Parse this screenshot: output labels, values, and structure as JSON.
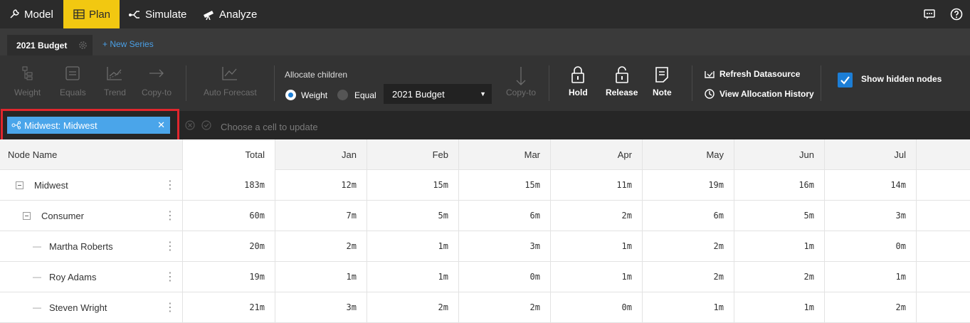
{
  "nav": {
    "model": "Model",
    "plan": "Plan",
    "simulate": "Simulate",
    "analyze": "Analyze",
    "active": "plan",
    "accent_color": "#f2c811"
  },
  "tabs": {
    "active_tab": "2021 Budget",
    "new_series": "+ New Series"
  },
  "ribbon": {
    "weight": "Weight",
    "equals": "Equals",
    "trend": "Trend",
    "copy_to_left": "Copy-to",
    "auto_forecast": "Auto Forecast",
    "allocate_children": "Allocate children",
    "radio_weight": "Weight",
    "radio_equal": "Equal",
    "radio_selected": "Weight",
    "series_select": "2021 Budget",
    "copy_to_right": "Copy-to",
    "hold": "Hold",
    "release": "Release",
    "note": "Note",
    "refresh_datasource": "Refresh Datasource",
    "view_allocation_history": "View Allocation History",
    "show_hidden_nodes": "Show hidden nodes",
    "show_hidden_checked": true
  },
  "filter": {
    "chip_label": "Midwest: Midwest",
    "hint": "Choose a cell to update"
  },
  "table": {
    "headers": [
      "Node Name",
      "Total",
      "Jan",
      "Feb",
      "Mar",
      "Apr",
      "May",
      "Jun",
      "Jul"
    ],
    "rows": [
      {
        "name": "Midwest",
        "level": 0,
        "control": "collapse",
        "values": [
          "183m",
          "12m",
          "15m",
          "15m",
          "11m",
          "19m",
          "16m",
          "14m"
        ]
      },
      {
        "name": "Consumer",
        "level": 1,
        "control": "collapse",
        "values": [
          "60m",
          "7m",
          "5m",
          "6m",
          "2m",
          "6m",
          "5m",
          "3m"
        ]
      },
      {
        "name": "Martha Roberts",
        "level": 2,
        "control": "leaf",
        "values": [
          "20m",
          "2m",
          "1m",
          "3m",
          "1m",
          "2m",
          "1m",
          "0m"
        ]
      },
      {
        "name": "Roy Adams",
        "level": 2,
        "control": "leaf",
        "values": [
          "19m",
          "1m",
          "1m",
          "0m",
          "1m",
          "2m",
          "2m",
          "1m"
        ]
      },
      {
        "name": "Steven Wright",
        "level": 2,
        "control": "leaf",
        "values": [
          "21m",
          "3m",
          "2m",
          "2m",
          "0m",
          "1m",
          "1m",
          "2m"
        ]
      }
    ]
  }
}
